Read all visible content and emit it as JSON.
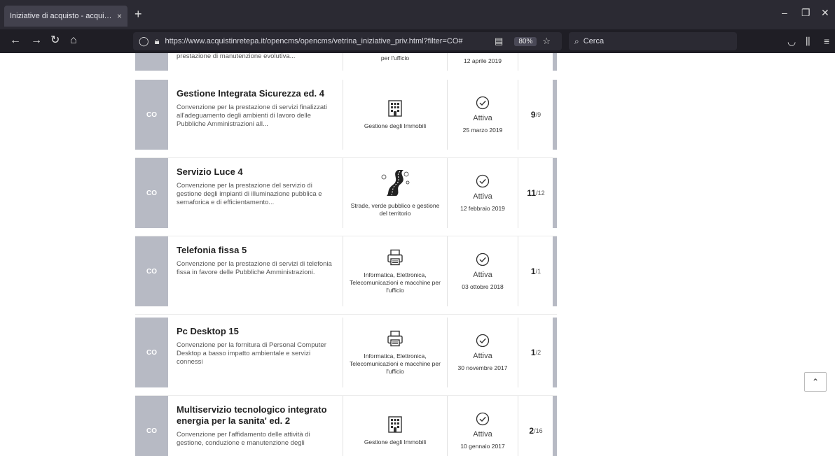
{
  "browser": {
    "tab_title": "Iniziative di acquisto - acquistinrete",
    "tab_close": "×",
    "new_tab": "+",
    "url": "https://www.acquistinretepa.it/opencms/opencms/vetrina_iniziative_priv.html?filter=CO#",
    "zoom": "80%",
    "search_placeholder": "Cerca"
  },
  "partial_row": {
    "desc": "prestazione di manutenzione evolutiva...",
    "category": "per l'ufficio",
    "date": "12 aprile 2019"
  },
  "rows": [
    {
      "badge": "CO",
      "title": "Gestione Integrata Sicurezza ed. 4",
      "desc": "Convenzione per la prestazione di servizi finalizzati all'adeguamento degli ambienti di lavoro delle Pubbliche Amministrazioni all...",
      "category": "Gestione degli Immobili",
      "icon": "building-icon",
      "status": "Attiva",
      "date": "25 marzo 2019",
      "lots_a": "9",
      "lots_b": "/9"
    },
    {
      "badge": "CO",
      "title": "Servizio Luce 4",
      "desc": "Convenzione per la prestazione del servizio di gestione degli impianti di illuminazione pubblica e semaforica e di efficientamento...",
      "category": "Strade, verde pubblico e gestione del territorio",
      "icon": "road-icon",
      "status": "Attiva",
      "date": "12 febbraio 2019",
      "lots_a": "11",
      "lots_b": "/12"
    },
    {
      "badge": "CO",
      "title": "Telefonia fissa 5",
      "desc": "Convenzione per la prestazione di servizi di telefonia fissa in favore delle Pubbliche Amministrazioni.",
      "category": "Informatica, Elettronica, Telecomunicazioni e macchine per l'ufficio",
      "icon": "printer-icon",
      "status": "Attiva",
      "date": "03 ottobre 2018",
      "lots_a": "1",
      "lots_b": "/1"
    },
    {
      "badge": "CO",
      "title": "Pc Desktop 15",
      "desc": "Convenzione per la fornitura di Personal Computer Desktop a basso impatto ambientale e servizi connessi",
      "category": "Informatica, Elettronica, Telecomunicazioni e macchine per l'ufficio",
      "icon": "printer-icon",
      "status": "Attiva",
      "date": "30 novembre 2017",
      "lots_a": "1",
      "lots_b": "/2"
    },
    {
      "badge": "CO",
      "title": "Multiservizio tecnologico integrato energia per la sanita' ed. 2",
      "desc": "Convenzione per l'affidamento delle attività di gestione, conduzione e manutenzione degli",
      "category": "Gestione degli Immobili",
      "icon": "building-icon",
      "status": "Attiva",
      "date": "10 gennaio 2017",
      "lots_a": "2",
      "lots_b": "/16"
    }
  ]
}
